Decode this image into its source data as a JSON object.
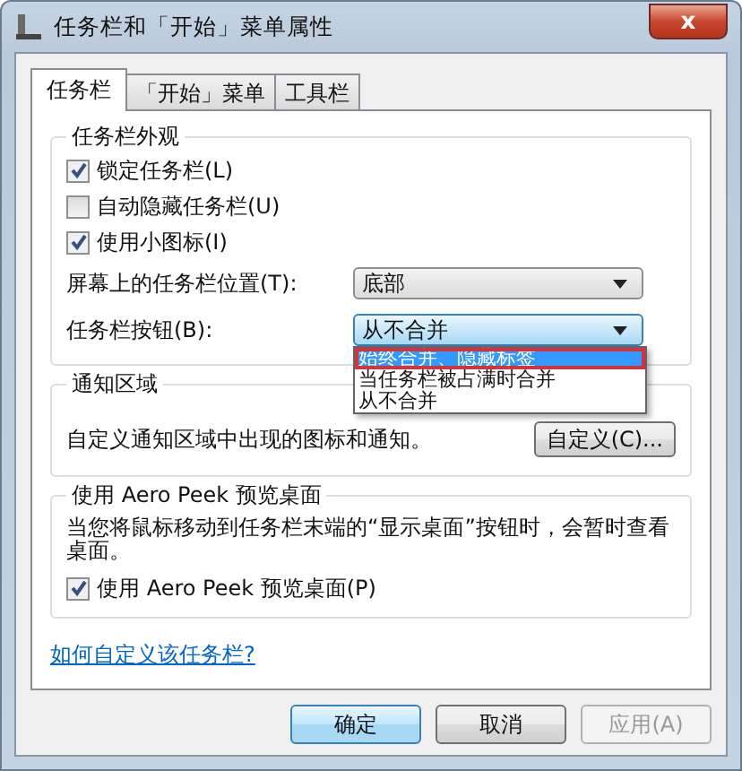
{
  "window": {
    "title": "任务栏和「开始」菜单属性",
    "close": "x"
  },
  "tabs": [
    {
      "label": "任务栏",
      "selected": true
    },
    {
      "label": "「开始」菜单",
      "selected": false
    },
    {
      "label": "工具栏",
      "selected": false
    }
  ],
  "appearance": {
    "title": "任务栏外观",
    "checkboxes": [
      {
        "label": "锁定任务栏(L)",
        "checked": true
      },
      {
        "label": "自动隐藏任务栏(U)",
        "checked": false
      },
      {
        "label": "使用小图标(I)",
        "checked": true
      }
    ],
    "position": {
      "label": "屏幕上的任务栏位置(T):",
      "value": "底部"
    },
    "taskbar_buttons": {
      "label": "任务栏按钮(B):",
      "value": "从不合并",
      "expanded": true,
      "options": [
        {
          "label": "始终合并、隐藏标签",
          "highlighted": true,
          "marked": true
        },
        {
          "label": "当任务栏被占满时合并",
          "highlighted": false,
          "marked": false
        },
        {
          "label": "从不合并",
          "highlighted": false,
          "marked": false
        }
      ]
    }
  },
  "notification": {
    "title": "通知区域",
    "description": "自定义通知区域中出现的图标和通知。",
    "button": "自定义(C)..."
  },
  "aero_peek": {
    "title": "使用 Aero Peek 预览桌面",
    "description": "当您将鼠标移动到任务栏末端的“显示桌面”按钮时，会暂时查看桌面。",
    "checkbox": {
      "label": "使用 Aero Peek 预览桌面(P)",
      "checked": true
    }
  },
  "help_link": "如何自定义该任务栏?",
  "buttons": [
    {
      "label": "确定",
      "kind": "default",
      "disabled": false
    },
    {
      "label": "取消",
      "kind": "normal",
      "disabled": false
    },
    {
      "label": "应用(A)",
      "kind": "normal",
      "disabled": true
    }
  ]
}
